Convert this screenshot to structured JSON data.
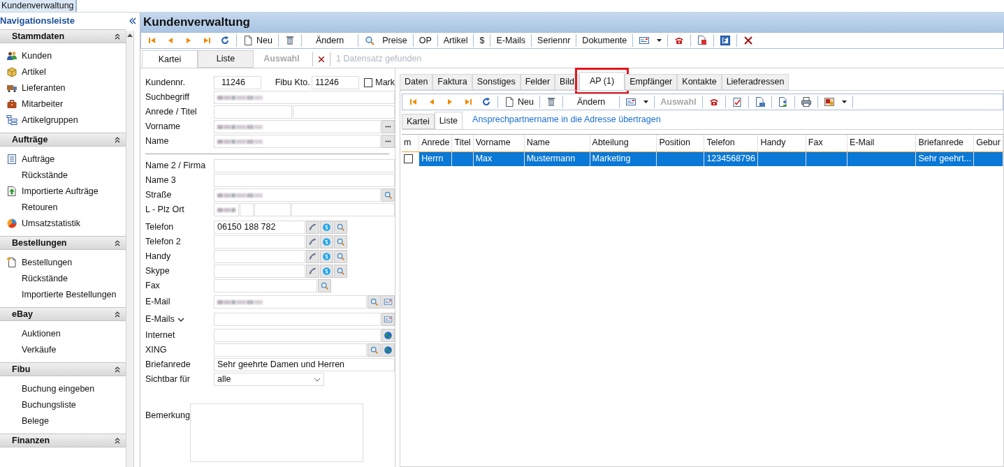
{
  "app_tab": "Kundenverwaltung",
  "sidebar": {
    "title": "Navigationsleiste",
    "groups": [
      {
        "title": "Stammdaten",
        "expanded": true,
        "items": [
          {
            "label": "Kunden"
          },
          {
            "label": "Artikel"
          },
          {
            "label": "Lieferanten"
          },
          {
            "label": "Mitarbeiter"
          },
          {
            "label": "Artikelgruppen"
          }
        ]
      },
      {
        "title": "Aufträge",
        "expanded": true,
        "items": [
          {
            "label": "Aufträge"
          },
          {
            "label": "Rückstände"
          },
          {
            "label": "Importierte Aufträge"
          },
          {
            "label": "Retouren"
          },
          {
            "label": "Umsatzstatistik"
          }
        ]
      },
      {
        "title": "Bestellungen",
        "expanded": true,
        "items": [
          {
            "label": "Bestellungen"
          },
          {
            "label": "Rückstände"
          },
          {
            "label": "Importierte Bestellungen"
          }
        ]
      },
      {
        "title": "eBay",
        "expanded": true,
        "items": [
          {
            "label": "Auktionen"
          },
          {
            "label": "Verkäufe"
          }
        ]
      },
      {
        "title": "Fibu",
        "expanded": true,
        "items": [
          {
            "label": "Buchung eingeben"
          },
          {
            "label": "Buchungsliste"
          },
          {
            "label": "Belege"
          }
        ]
      },
      {
        "title": "Finanzen",
        "expanded": true
      }
    ]
  },
  "window": {
    "title": "Kundenverwaltung"
  },
  "toolbar": [
    {
      "kind": "button"
    },
    {
      "kind": "button"
    },
    {
      "kind": "button"
    },
    {
      "kind": "button"
    },
    {
      "kind": "button"
    },
    {
      "kind": "separator"
    },
    {
      "kind": "button",
      "label": "Neu"
    },
    {
      "kind": "separator"
    },
    {
      "kind": "button"
    },
    {
      "kind": "separator"
    },
    {
      "kind": "button",
      "label": "Ändern"
    },
    {
      "kind": "separator"
    },
    {
      "kind": "button"
    },
    {
      "kind": "button",
      "label": "Preise"
    },
    {
      "kind": "separator"
    },
    {
      "kind": "button",
      "label": "OP"
    },
    {
      "kind": "separator"
    },
    {
      "kind": "button",
      "label": "Artikel"
    },
    {
      "kind": "separator"
    },
    {
      "kind": "button",
      "label": "$"
    },
    {
      "kind": "separator"
    },
    {
      "kind": "button",
      "label": "E-Mails"
    },
    {
      "kind": "separator"
    },
    {
      "kind": "button",
      "label": "Seriennr"
    },
    {
      "kind": "separator"
    },
    {
      "kind": "button",
      "label": "Dokumente"
    },
    {
      "kind": "separator"
    },
    {
      "kind": "button"
    },
    {
      "kind": "button"
    },
    {
      "kind": "separator"
    },
    {
      "kind": "button"
    },
    {
      "kind": "separator"
    },
    {
      "kind": "button"
    },
    {
      "kind": "separator"
    },
    {
      "kind": "button"
    },
    {
      "kind": "separator"
    },
    {
      "kind": "button"
    }
  ],
  "view_tabs": [
    {
      "label": "Kartei",
      "selected": true,
      "disabled": false
    },
    {
      "label": "Liste",
      "selected": false,
      "disabled": false
    },
    {
      "label": "Auswahl",
      "selected": false,
      "disabled": true
    }
  ],
  "record_status": "1 Datensatz gefunden",
  "form": {
    "kundennr": {
      "label": "Kundennr.",
      "value": "11246"
    },
    "fibu": {
      "label": "Fibu Kto.",
      "value": "11246"
    },
    "mark": {
      "label": "Mark",
      "checked": false
    },
    "rows": [
      {
        "kind": "text",
        "label": "Suchbegriff",
        "redacted": true
      },
      {
        "kind": "split",
        "label": "Anrede / Titel"
      },
      {
        "kind": "text",
        "label": "Vorname",
        "redacted": true
      },
      {
        "kind": "text",
        "label": "Name",
        "redacted": true
      },
      {
        "kind": "divider"
      },
      {
        "kind": "text",
        "label": "Name 2 / Firma"
      },
      {
        "kind": "text",
        "label": "Name 3"
      },
      {
        "kind": "text",
        "label": "Straße",
        "redacted": true
      },
      {
        "kind": "address",
        "label": "L - Plz Ort",
        "redacted": true
      },
      {
        "kind": "phone",
        "label": "Telefon",
        "value": "06150 188 782"
      },
      {
        "kind": "phone",
        "label": "Telefon 2"
      },
      {
        "kind": "phone",
        "label": "Handy"
      },
      {
        "kind": "phone",
        "label": "Skype"
      },
      {
        "kind": "short",
        "label": "Fax"
      },
      {
        "kind": "text",
        "label": "E-Mail",
        "redacted": true
      },
      {
        "kind": "menu",
        "label": "E-Mails"
      },
      {
        "kind": "text",
        "label": "Internet"
      },
      {
        "kind": "text",
        "label": "XING"
      },
      {
        "kind": "text",
        "label": "Briefanrede",
        "value": "Sehr geehrte Damen und Herren"
      },
      {
        "kind": "select",
        "label": "Sichtbar für",
        "value": "alle"
      },
      {
        "kind": "textarea",
        "label": "Bemerkung"
      }
    ]
  },
  "detail_tabs": [
    {
      "label": "Daten",
      "selected": false
    },
    {
      "label": "Faktura",
      "selected": false
    },
    {
      "label": "Sonstiges",
      "selected": false
    },
    {
      "label": "Felder",
      "selected": false
    },
    {
      "label": "Bild",
      "selected": false
    },
    {
      "label": "AP (1)",
      "selected": true,
      "highlighted": true
    },
    {
      "label": "Empfänger",
      "selected": false
    },
    {
      "label": "Kontakte",
      "selected": false
    },
    {
      "label": "Lieferadressen",
      "selected": false
    }
  ],
  "detail_toolbar": [
    {
      "kind": "button"
    },
    {
      "kind": "button"
    },
    {
      "kind": "button"
    },
    {
      "kind": "button"
    },
    {
      "kind": "button"
    },
    {
      "kind": "separator"
    },
    {
      "kind": "button",
      "label": "Neu"
    },
    {
      "kind": "separator"
    },
    {
      "kind": "button"
    },
    {
      "kind": "separator"
    },
    {
      "kind": "button",
      "label": "Ändern"
    },
    {
      "kind": "separator"
    },
    {
      "kind": "button"
    },
    {
      "kind": "button"
    },
    {
      "kind": "separator"
    },
    {
      "kind": "button",
      "label": "Auswahl",
      "disabled": true
    },
    {
      "kind": "separator"
    },
    {
      "kind": "button"
    },
    {
      "kind": "separator"
    },
    {
      "kind": "button"
    },
    {
      "kind": "separator"
    },
    {
      "kind": "button"
    },
    {
      "kind": "separator"
    },
    {
      "kind": "button"
    },
    {
      "kind": "separator"
    },
    {
      "kind": "button"
    },
    {
      "kind": "separator"
    },
    {
      "kind": "button"
    },
    {
      "kind": "button"
    },
    {
      "kind": "separator"
    }
  ],
  "sub_tabs": [
    {
      "label": "Kartei",
      "selected": false
    },
    {
      "label": "Liste",
      "selected": true
    }
  ],
  "transfer_link": "Ansprechpartnername in die Adresse übertragen",
  "table": {
    "columns": [
      "m",
      "Anrede",
      "Titel",
      "Vorname",
      "Name",
      "Abteilung",
      "Position",
      "Telefon",
      "Handy",
      "Fax",
      "E-Mail",
      "Briefanrede",
      "Gebur"
    ],
    "rows": [
      {
        "selected": true,
        "checked": false,
        "cells": [
          "",
          "Herrn",
          "",
          "Max",
          "Mustermann",
          "Marketing",
          "",
          "1234568796",
          "",
          "",
          "",
          "Sehr geehrt...",
          ""
        ]
      }
    ]
  }
}
